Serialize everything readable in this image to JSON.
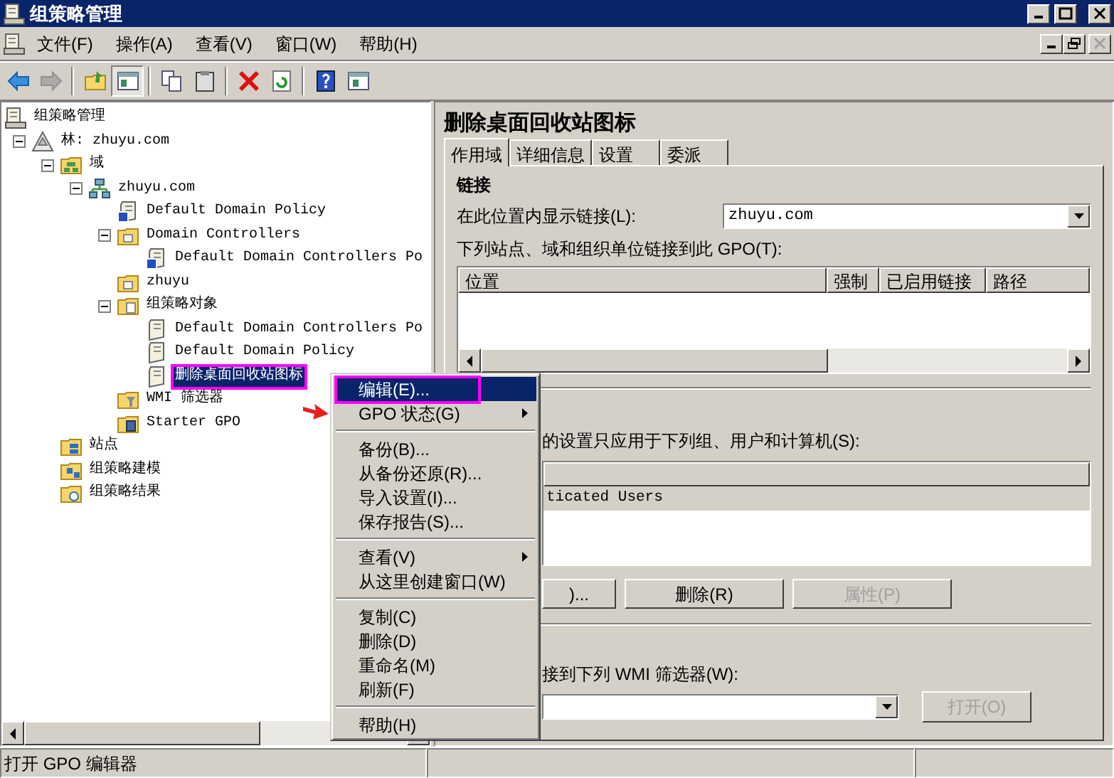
{
  "window": {
    "title": "组策略管理"
  },
  "menu_bar": [
    "文件(F)",
    "操作(A)",
    "查看(V)",
    "窗口(W)",
    "帮助(H)"
  ],
  "toolbar": [
    {
      "kind": "back",
      "disabled": false,
      "pressed": false
    },
    {
      "kind": "forward",
      "disabled": true,
      "pressed": false
    },
    {
      "kind": "separator"
    },
    {
      "kind": "up",
      "disabled": false,
      "pressed": false
    },
    {
      "kind": "tree",
      "disabled": false,
      "pressed": true
    },
    {
      "kind": "separator"
    },
    {
      "kind": "copy",
      "disabled": false,
      "pressed": false
    },
    {
      "kind": "paste",
      "disabled": false,
      "pressed": false
    },
    {
      "kind": "separator"
    },
    {
      "kind": "delete",
      "disabled": false,
      "pressed": false
    },
    {
      "kind": "refresh",
      "disabled": false,
      "pressed": false
    },
    {
      "kind": "separator"
    },
    {
      "kind": "help",
      "disabled": false,
      "pressed": false
    },
    {
      "kind": "panel",
      "disabled": false,
      "pressed": false
    }
  ],
  "tree": {
    "label": "组策略管理",
    "kind": "console",
    "selected": false,
    "outlined": false,
    "children": [
      {
        "label": "林: zhuyu.com",
        "kind": "forest",
        "expanded": true,
        "selected": false,
        "outlined": false,
        "children": [
          {
            "label": "域",
            "kind": "domains",
            "expanded": true,
            "selected": false,
            "outlined": false,
            "children": [
              {
                "label": "zhuyu.com",
                "kind": "domain",
                "expanded": true,
                "selected": false,
                "outlined": false,
                "children": [
                  {
                    "label": "Default Domain Policy",
                    "kind": "link",
                    "selected": false,
                    "outlined": false
                  },
                  {
                    "label": "Domain Controllers",
                    "kind": "ou",
                    "expanded": true,
                    "selected": false,
                    "outlined": false,
                    "children": [
                      {
                        "label": "Default Domain Controllers Po",
                        "kind": "link",
                        "selected": false,
                        "outlined": false
                      }
                    ]
                  },
                  {
                    "label": "zhuyu",
                    "kind": "ou",
                    "selected": false,
                    "outlined": false
                  },
                  {
                    "label": "组策略对象",
                    "kind": "gpofolder",
                    "expanded": true,
                    "selected": false,
                    "outlined": false,
                    "children": [
                      {
                        "label": "Default Domain Controllers Po",
                        "kind": "gpo",
                        "selected": false,
                        "outlined": false
                      },
                      {
                        "label": "Default Domain Policy",
                        "kind": "gpo",
                        "selected": false,
                        "outlined": false
                      },
                      {
                        "label": "删除桌面回收站图标",
                        "kind": "gpo",
                        "selected": true,
                        "outlined": true
                      }
                    ]
                  },
                  {
                    "label": "WMI 筛选器",
                    "kind": "wmi",
                    "selected": false,
                    "outlined": false
                  },
                  {
                    "label": "Starter GPO",
                    "kind": "starter",
                    "selected": false,
                    "outlined": false
                  }
                ]
              }
            ]
          },
          {
            "label": "站点",
            "kind": "sites",
            "selected": false,
            "outlined": false
          },
          {
            "label": "组策略建模",
            "kind": "modeling",
            "selected": false,
            "outlined": false
          },
          {
            "label": "组策略结果",
            "kind": "results",
            "selected": false,
            "outlined": false
          }
        ]
      }
    ]
  },
  "details": {
    "title": "删除桌面回收站图标",
    "tabs": [
      {
        "label": "作用域",
        "selected": true
      },
      {
        "label": "详细信息",
        "selected": false
      },
      {
        "label": "设置",
        "selected": false
      },
      {
        "label": "委派",
        "selected": false
      }
    ],
    "links": {
      "heading": "链接",
      "location_label": "在此位置内显示链接(L):",
      "location_value": "zhuyu.com",
      "list_label": "下列站点、域和组织单位链接到此 GPO(T):",
      "columns": [
        "位置",
        "强制",
        "已启用链接",
        "路径"
      ]
    },
    "security": {
      "label": "的设置只应用于下列组、用户和计算机(S):",
      "rows": [
        {
          "name": "ticated Users",
          "selected": true
        }
      ],
      "buttons": [
        {
          "label": ")...",
          "disabled": false
        },
        {
          "label": "删除(R)",
          "disabled": false
        },
        {
          "label": "属性(P)",
          "disabled": true
        }
      ]
    },
    "wmi": {
      "label": "接到下列 WMI 筛选器(W):",
      "open_button": {
        "label": "打开(O)",
        "disabled": true
      }
    }
  },
  "context_menu": [
    {
      "kind": "item",
      "label": "编辑(E)...",
      "selected": true,
      "outlined": true,
      "submenu": false
    },
    {
      "kind": "item",
      "label": "GPO 状态(G)",
      "selected": false,
      "outlined": false,
      "submenu": true
    },
    {
      "kind": "separator"
    },
    {
      "kind": "item",
      "label": "备份(B)...",
      "selected": false,
      "outlined": false,
      "submenu": false
    },
    {
      "kind": "item",
      "label": "从备份还原(R)...",
      "selected": false,
      "outlined": false,
      "submenu": false
    },
    {
      "kind": "item",
      "label": "导入设置(I)...",
      "selected": false,
      "outlined": false,
      "submenu": false
    },
    {
      "kind": "item",
      "label": "保存报告(S)...",
      "selected": false,
      "outlined": false,
      "submenu": false
    },
    {
      "kind": "separator"
    },
    {
      "kind": "item",
      "label": "查看(V)",
      "selected": false,
      "outlined": false,
      "submenu": true
    },
    {
      "kind": "item",
      "label": "从这里创建窗口(W)",
      "selected": false,
      "outlined": false,
      "submenu": false
    },
    {
      "kind": "separator"
    },
    {
      "kind": "item",
      "label": "复制(C)",
      "selected": false,
      "outlined": false,
      "submenu": false
    },
    {
      "kind": "item",
      "label": "删除(D)",
      "selected": false,
      "outlined": false,
      "submenu": false
    },
    {
      "kind": "item",
      "label": "重命名(M)",
      "selected": false,
      "outlined": false,
      "submenu": false
    },
    {
      "kind": "item",
      "label": "刷新(F)",
      "selected": false,
      "outlined": false,
      "submenu": false
    },
    {
      "kind": "separator"
    },
    {
      "kind": "item",
      "label": "帮助(H)",
      "selected": false,
      "outlined": false,
      "submenu": false
    }
  ],
  "status_bar": "打开 GPO 编辑器"
}
